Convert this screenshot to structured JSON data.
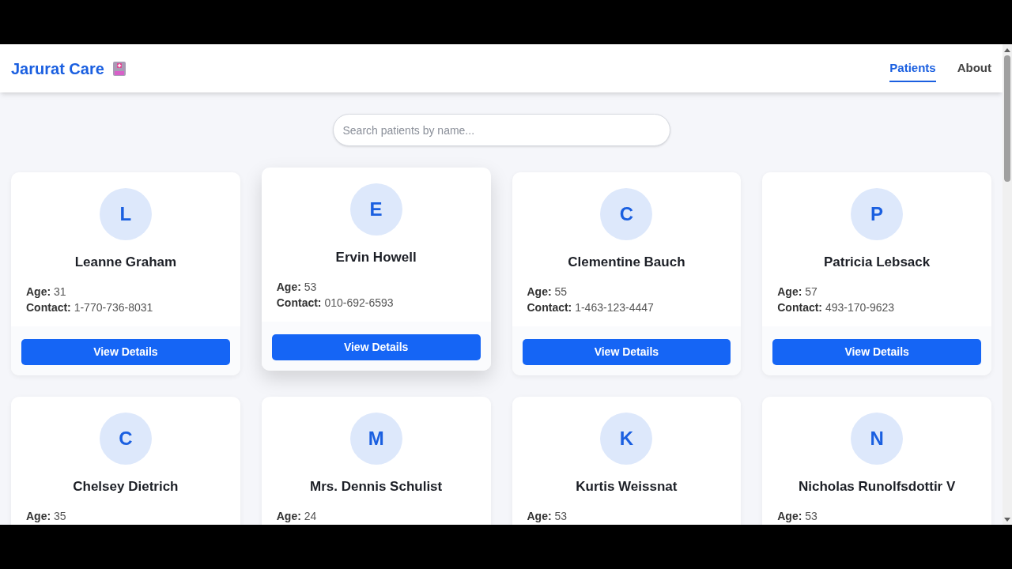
{
  "header": {
    "brand": "Jarurat Care",
    "nav": [
      {
        "label": "Patients",
        "selected": true
      },
      {
        "label": "About",
        "selected": false
      }
    ]
  },
  "search": {
    "placeholder": "Search patients by name..."
  },
  "patients": [
    {
      "initial": "L",
      "name": "Leanne Graham",
      "age_label": "Age:",
      "age": "31",
      "contact_label": "Contact:",
      "contact": "1-770-736-8031",
      "button": "View Details",
      "hovered": false
    },
    {
      "initial": "E",
      "name": "Ervin Howell",
      "age_label": "Age:",
      "age": "53",
      "contact_label": "Contact:",
      "contact": "010-692-6593",
      "button": "View Details",
      "hovered": true
    },
    {
      "initial": "C",
      "name": "Clementine Bauch",
      "age_label": "Age:",
      "age": "55",
      "contact_label": "Contact:",
      "contact": "1-463-123-4447",
      "button": "View Details",
      "hovered": false
    },
    {
      "initial": "P",
      "name": "Patricia Lebsack",
      "age_label": "Age:",
      "age": "57",
      "contact_label": "Contact:",
      "contact": "493-170-9623",
      "button": "View Details",
      "hovered": false
    },
    {
      "initial": "C",
      "name": "Chelsey Dietrich",
      "age_label": "Age:",
      "age": "35",
      "hovered": false
    },
    {
      "initial": "M",
      "name": "Mrs. Dennis Schulist",
      "age_label": "Age:",
      "age": "24",
      "hovered": false
    },
    {
      "initial": "K",
      "name": "Kurtis Weissnat",
      "age_label": "Age:",
      "age": "53",
      "hovered": false
    },
    {
      "initial": "N",
      "name": "Nicholas Runolfsdottir V",
      "age_label": "Age:",
      "age": "53",
      "hovered": false
    }
  ]
}
